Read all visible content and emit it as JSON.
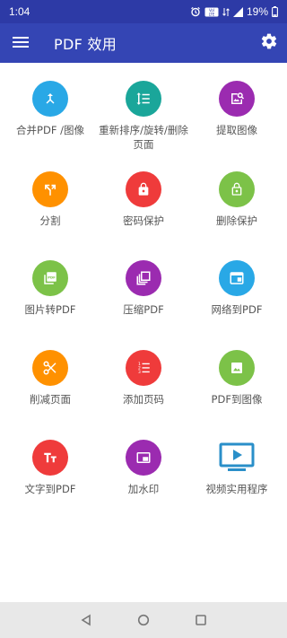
{
  "status": {
    "time": "1:04",
    "battery": "19%"
  },
  "app": {
    "title": "PDF 效用"
  },
  "colors": {
    "status_bar": "#2d3aa6",
    "app_bar": "#3445b4",
    "blue": "#29a8e6",
    "teal": "#1aa69a",
    "purple": "#9b2bb0",
    "orange": "#ff9100",
    "red": "#ef3b3b",
    "green": "#7cc248",
    "video_blue": "#2a8fc9"
  },
  "tools": [
    {
      "label": "合并PDF /图像",
      "icon": "merge-icon"
    },
    {
      "label": "重新排序/旋转/删除页面",
      "icon": "reorder-icon"
    },
    {
      "label": "提取图像",
      "icon": "extract-image-icon"
    },
    {
      "label": "分割",
      "icon": "split-icon"
    },
    {
      "label": "密码保护",
      "icon": "lock-icon"
    },
    {
      "label": "删除保护",
      "icon": "unlock-icon"
    },
    {
      "label": "图片转PDF",
      "icon": "image-to-pdf-icon"
    },
    {
      "label": "压缩PDF",
      "icon": "compress-icon"
    },
    {
      "label": "网络到PDF",
      "icon": "web-icon"
    },
    {
      "label": "削减页面",
      "icon": "scissors-icon"
    },
    {
      "label": "添加页码",
      "icon": "page-number-icon"
    },
    {
      "label": "PDF到图像",
      "icon": "image-icon"
    },
    {
      "label": "文字到PDF",
      "icon": "text-icon"
    },
    {
      "label": "加水印",
      "icon": "watermark-icon"
    },
    {
      "label": "视频实用程序",
      "icon": "video-icon"
    }
  ]
}
